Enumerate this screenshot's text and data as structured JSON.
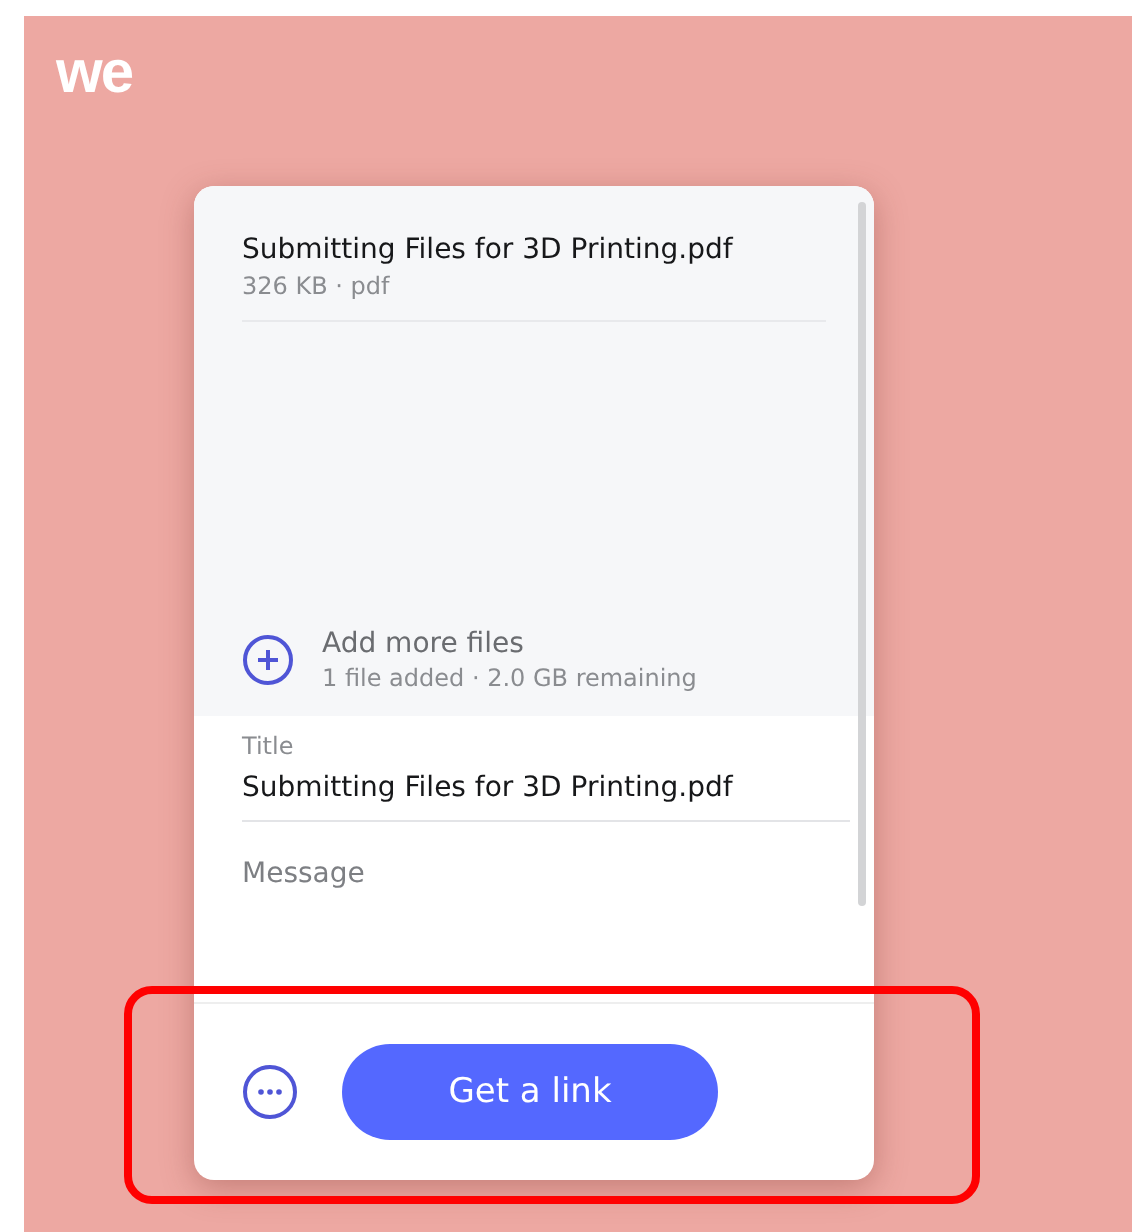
{
  "logo": "we",
  "file": {
    "name": "Submitting Files for 3D Printing.pdf",
    "meta": "326 KB · pdf"
  },
  "add_more": {
    "label": "Add more files",
    "info": "1 file added · 2.0 GB remaining"
  },
  "title_field": {
    "label": "Title",
    "value": "Submitting Files for 3D Printing.pdf"
  },
  "message_field": {
    "placeholder": "Message"
  },
  "get_link_button": {
    "label": "Get a link"
  },
  "annotation": {
    "kind": "frame"
  }
}
